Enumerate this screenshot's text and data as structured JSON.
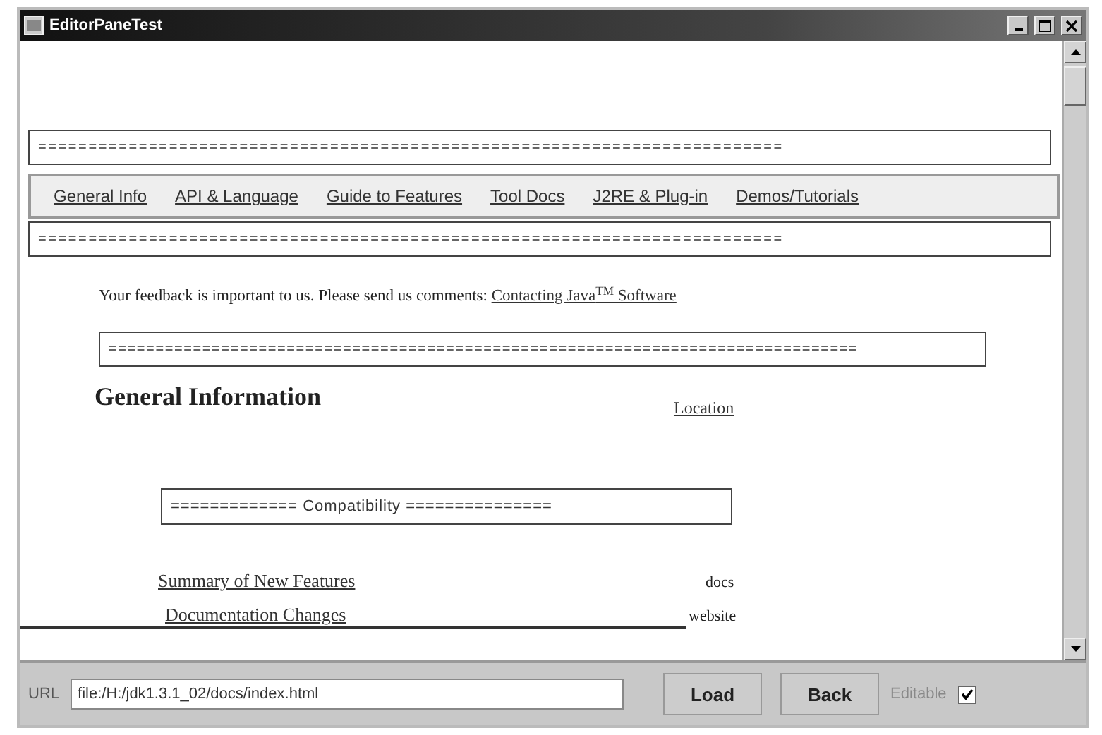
{
  "window": {
    "title": "EditorPaneTest"
  },
  "document": {
    "rule_top": "==========================================================================",
    "nav_links": [
      "General Info",
      "API & Language",
      "Guide to Features",
      "Tool Docs",
      "J2RE & Plug-in",
      "Demos/Tutorials"
    ],
    "rule_bottom": "==========================================================================",
    "feedback": "Your feedback is important to us. Please send us comments:",
    "feedback_link": "Contacting Java$^{TM}$ Software",
    "rule_middle": "================================================================================",
    "heading": "General Information",
    "location_link": "Location",
    "section_rule": "============= Compatibility ===============",
    "rows": [
      {
        "link": "Summary of New Features",
        "note": "docs"
      },
      {
        "link": "Documentation Changes",
        "note": "website"
      }
    ]
  },
  "url_bar": {
    "label": "URL",
    "value": "file:/H:/jdk1.3.1_02/docs/index.html",
    "buttons": [
      "Load",
      "Back"
    ],
    "editable": {
      "label": "Editable",
      "checked": true
    }
  }
}
